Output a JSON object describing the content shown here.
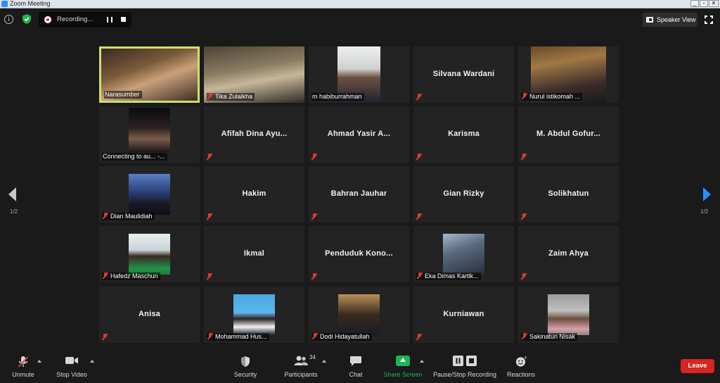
{
  "window": {
    "title": "Zoom Meeting"
  },
  "topbar": {
    "recording_label": "Recording...",
    "speaker_view_label": "Speaker View"
  },
  "pagination": {
    "left": "1/2",
    "right": "1/2"
  },
  "tiles": [
    {
      "name": "Narasumber",
      "mode": "video",
      "muted": false,
      "active": true
    },
    {
      "name": "Tika Zulaikha",
      "mode": "video",
      "muted": true
    },
    {
      "name": "m habiburrahman",
      "mode": "video",
      "muted": false
    },
    {
      "name": "Silvana Wardani",
      "mode": "name",
      "muted": true
    },
    {
      "name": "Nurul istikomah ...",
      "mode": "video",
      "muted": true
    },
    {
      "name": "Connecting to au... -...",
      "mode": "video",
      "muted": false
    },
    {
      "name": "Afifah Dina Ayu...",
      "mode": "name",
      "muted": true
    },
    {
      "name": "Ahmad Yasir A...",
      "mode": "name",
      "muted": true
    },
    {
      "name": "Karisma",
      "mode": "name",
      "muted": true
    },
    {
      "name": "M. Abdul Gofur...",
      "mode": "name",
      "muted": true
    },
    {
      "name": "Dian Maulidiah",
      "mode": "video",
      "muted": true
    },
    {
      "name": "Hakim",
      "mode": "name",
      "muted": true
    },
    {
      "name": "Bahran Jauhar",
      "mode": "name",
      "muted": true
    },
    {
      "name": "Gian Rizky",
      "mode": "name",
      "muted": true
    },
    {
      "name": "Solikhatun",
      "mode": "name",
      "muted": true
    },
    {
      "name": "Hafedz Maschun",
      "mode": "video",
      "muted": true
    },
    {
      "name": "Ikmal",
      "mode": "name",
      "muted": true
    },
    {
      "name": "Penduduk  Kono...",
      "mode": "name",
      "muted": true
    },
    {
      "name": "Eka Dimas Kartik...",
      "mode": "video",
      "muted": true
    },
    {
      "name": "Zaim Ahya",
      "mode": "name",
      "muted": true
    },
    {
      "name": "Anisa",
      "mode": "name",
      "muted": true
    },
    {
      "name": "Mohammad Hus...",
      "mode": "video",
      "muted": true
    },
    {
      "name": "Dodi Hidayatullah",
      "mode": "video",
      "muted": true
    },
    {
      "name": "Kurniawan",
      "mode": "name",
      "muted": true
    },
    {
      "name": "Sakinatun Nisak",
      "mode": "video",
      "muted": true
    }
  ],
  "toolbar": {
    "unmute": "Unmute",
    "stop_video": "Stop Video",
    "security": "Security",
    "participants": "Participants",
    "participants_count": "34",
    "chat": "Chat",
    "share_screen": "Share Screen",
    "pause_stop_recording": "Pause/Stop Recording",
    "reactions": "Reactions",
    "leave": "Leave"
  },
  "colors": {
    "active_speaker_border": "#c9e36a",
    "share_screen_green": "#1fb554",
    "leave_red": "#d7251f",
    "nav_right_blue": "#2d8cff",
    "muted_red": "#e03b3b"
  }
}
